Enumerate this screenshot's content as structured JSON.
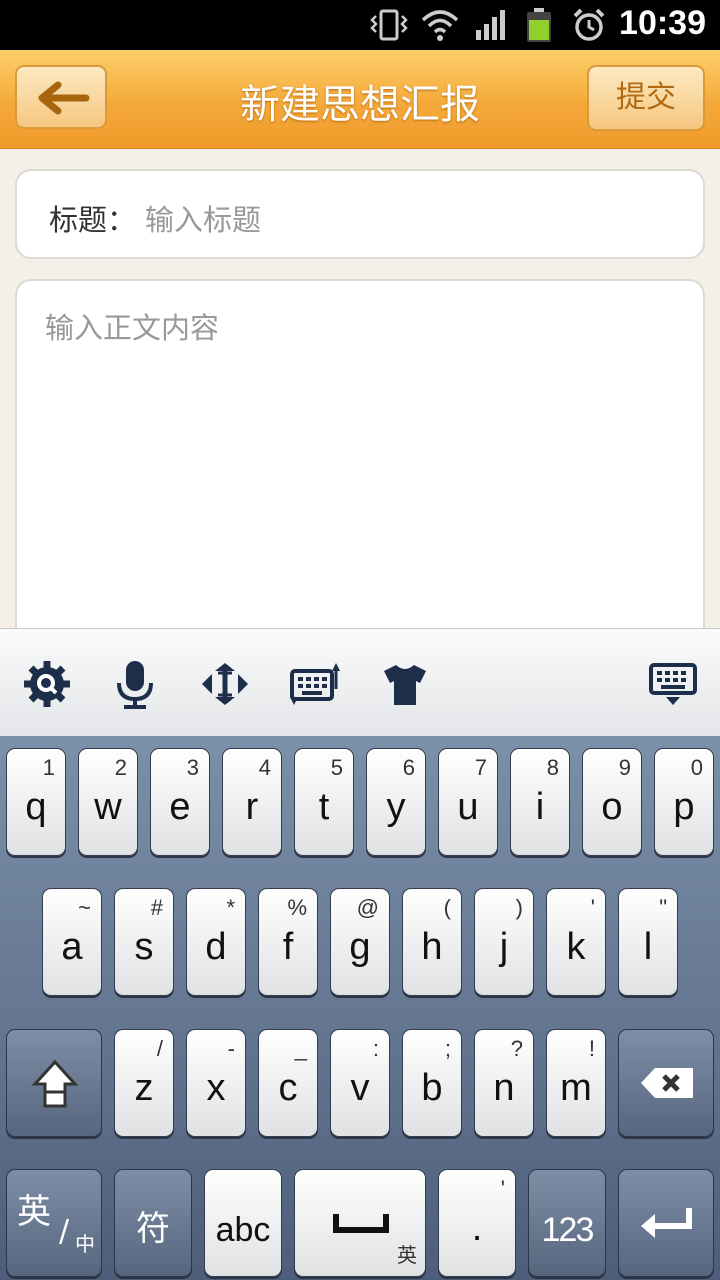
{
  "status_bar": {
    "time": "10:39",
    "icons": [
      "vibrate-icon",
      "wifi-icon",
      "signal-icon",
      "battery-icon",
      "alarm-icon"
    ]
  },
  "header": {
    "title": "新建思想汇报",
    "submit_label": "提交",
    "back_icon": "back-arrow-icon"
  },
  "form": {
    "title_label": "标题：",
    "title_placeholder": "输入标题",
    "body_placeholder": "输入正文内容"
  },
  "kb_toolbar": {
    "icons": [
      "settings-icon",
      "microphone-icon",
      "cursor-move-icon",
      "keyboard-switch-icon",
      "theme-shirt-icon",
      "hide-keyboard-icon"
    ]
  },
  "keyboard": {
    "row1": [
      {
        "main": "q",
        "sub": "1"
      },
      {
        "main": "w",
        "sub": "2"
      },
      {
        "main": "e",
        "sub": "3"
      },
      {
        "main": "r",
        "sub": "4"
      },
      {
        "main": "t",
        "sub": "5"
      },
      {
        "main": "y",
        "sub": "6"
      },
      {
        "main": "u",
        "sub": "7"
      },
      {
        "main": "i",
        "sub": "8"
      },
      {
        "main": "o",
        "sub": "9"
      },
      {
        "main": "p",
        "sub": "0"
      }
    ],
    "row2": [
      {
        "main": "a",
        "sub": "~"
      },
      {
        "main": "s",
        "sub": "#"
      },
      {
        "main": "d",
        "sub": "*"
      },
      {
        "main": "f",
        "sub": "%"
      },
      {
        "main": "g",
        "sub": "@"
      },
      {
        "main": "h",
        "sub": "("
      },
      {
        "main": "j",
        "sub": ")"
      },
      {
        "main": "k",
        "sub": "'"
      },
      {
        "main": "l",
        "sub": "\""
      }
    ],
    "row3": [
      {
        "main": "z",
        "sub": "/"
      },
      {
        "main": "x",
        "sub": "-"
      },
      {
        "main": "c",
        "sub": "_"
      },
      {
        "main": "v",
        "sub": ":"
      },
      {
        "main": "b",
        "sub": ";"
      },
      {
        "main": "n",
        "sub": "?"
      },
      {
        "main": "m",
        "sub": "!"
      }
    ],
    "lang_key": "英",
    "lang_key_sub": "中",
    "symbol_key": "符",
    "abc_key": "abc",
    "space_sub": "英",
    "period_key": ".",
    "period_sub": "'",
    "num_key": "123"
  }
}
